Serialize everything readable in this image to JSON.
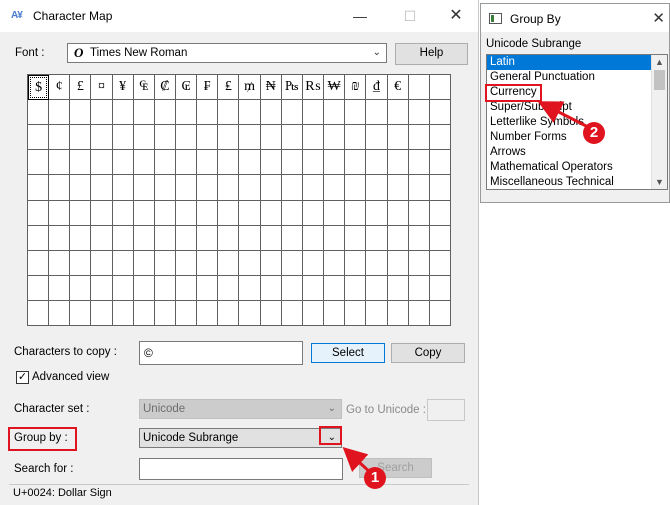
{
  "charmap": {
    "title": "Character Map",
    "font_label": "Font :",
    "font_value": "Times New Roman",
    "help_label": "Help",
    "characters": [
      "$",
      "¢",
      "£",
      "¤",
      "¥",
      "₠",
      "₡",
      "₢",
      "₣",
      "₤",
      "₥",
      "₦",
      "₧",
      "₨",
      "₩",
      "₪",
      "₫",
      "€"
    ],
    "chars_to_copy_label": "Characters to copy :",
    "chars_to_copy_value": "©",
    "select_label": "Select",
    "copy_label": "Copy",
    "advanced_view_label": "Advanced view",
    "advanced_view_checked": "✓",
    "character_set_label": "Character set :",
    "character_set_value": "Unicode",
    "goto_unicode_label": "Go to Unicode :",
    "group_by_label": "Group by :",
    "group_by_value": "Unicode Subrange",
    "search_for_label": "Search for :",
    "search_label": "Search",
    "status": "U+0024: Dollar Sign"
  },
  "groupby": {
    "title": "Group By",
    "list_label": "Unicode Subrange",
    "items": [
      "Latin",
      "General Punctuation",
      "Currency",
      "Super/Subscript",
      "Letterlike Symbols",
      "Number Forms",
      "Arrows",
      "Mathematical Operators",
      "Miscellaneous Technical"
    ]
  },
  "annotations": {
    "badge_1": "1",
    "badge_2": "2"
  },
  "colors": {
    "annotation_red": "#e0141e",
    "selection_blue": "#0078d7"
  }
}
